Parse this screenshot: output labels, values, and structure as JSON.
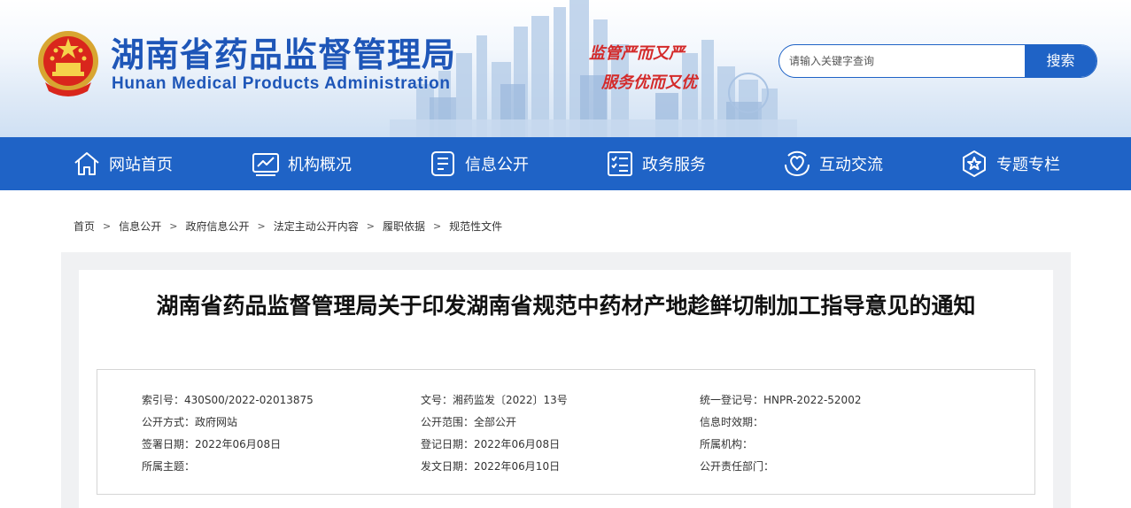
{
  "header": {
    "title_cn": "湖南省药品监督管理局",
    "title_en": "Hunan Medical Products Administration",
    "slogan_line1": "监管严而又严",
    "slogan_line2": "服务优而又优",
    "emblem_icon": "national-emblem-icon",
    "colors": {
      "brand_blue": "#1e56b8",
      "nav_blue": "#1f63c6",
      "slogan_red": "#d42a2a"
    }
  },
  "search": {
    "placeholder": "请输入关键字查询",
    "button_label": "搜索"
  },
  "nav": {
    "items": [
      {
        "label": "网站首页",
        "icon": "home-icon"
      },
      {
        "label": "机构概况",
        "icon": "chart-monitor-icon"
      },
      {
        "label": "信息公开",
        "icon": "info-document-icon"
      },
      {
        "label": "政务服务",
        "icon": "checklist-icon"
      },
      {
        "label": "互动交流",
        "icon": "heart-hands-icon"
      },
      {
        "label": "专题专栏",
        "icon": "star-badge-icon"
      }
    ]
  },
  "breadcrumb": {
    "items": [
      "首页",
      "信息公开",
      "政府信息公开",
      "法定主动公开内容",
      "履职依据",
      "规范性文件"
    ],
    "separator": ">"
  },
  "article": {
    "title": "湖南省药品监督管理局关于印发湖南省规范中药材产地趁鲜切制加工指导意见的通知"
  },
  "info": {
    "index_no": "索引号：430S00/2022-02013875",
    "doc_no": "文号：湘药监发〔2022〕13号",
    "unified_reg_no": "统一登记号：HNPR-2022-52002",
    "publish_method": "公开方式：政府网站",
    "publish_scope": "公开范围：全部公开",
    "validity": "信息时效期：",
    "sign_date": "签署日期：2022年06月08日",
    "reg_date": "登记日期：2022年06月08日",
    "org": "所属机构：",
    "topic": "所属主题：",
    "issue_date": "发文日期：2022年06月10日",
    "dept": "公开责任部门："
  }
}
